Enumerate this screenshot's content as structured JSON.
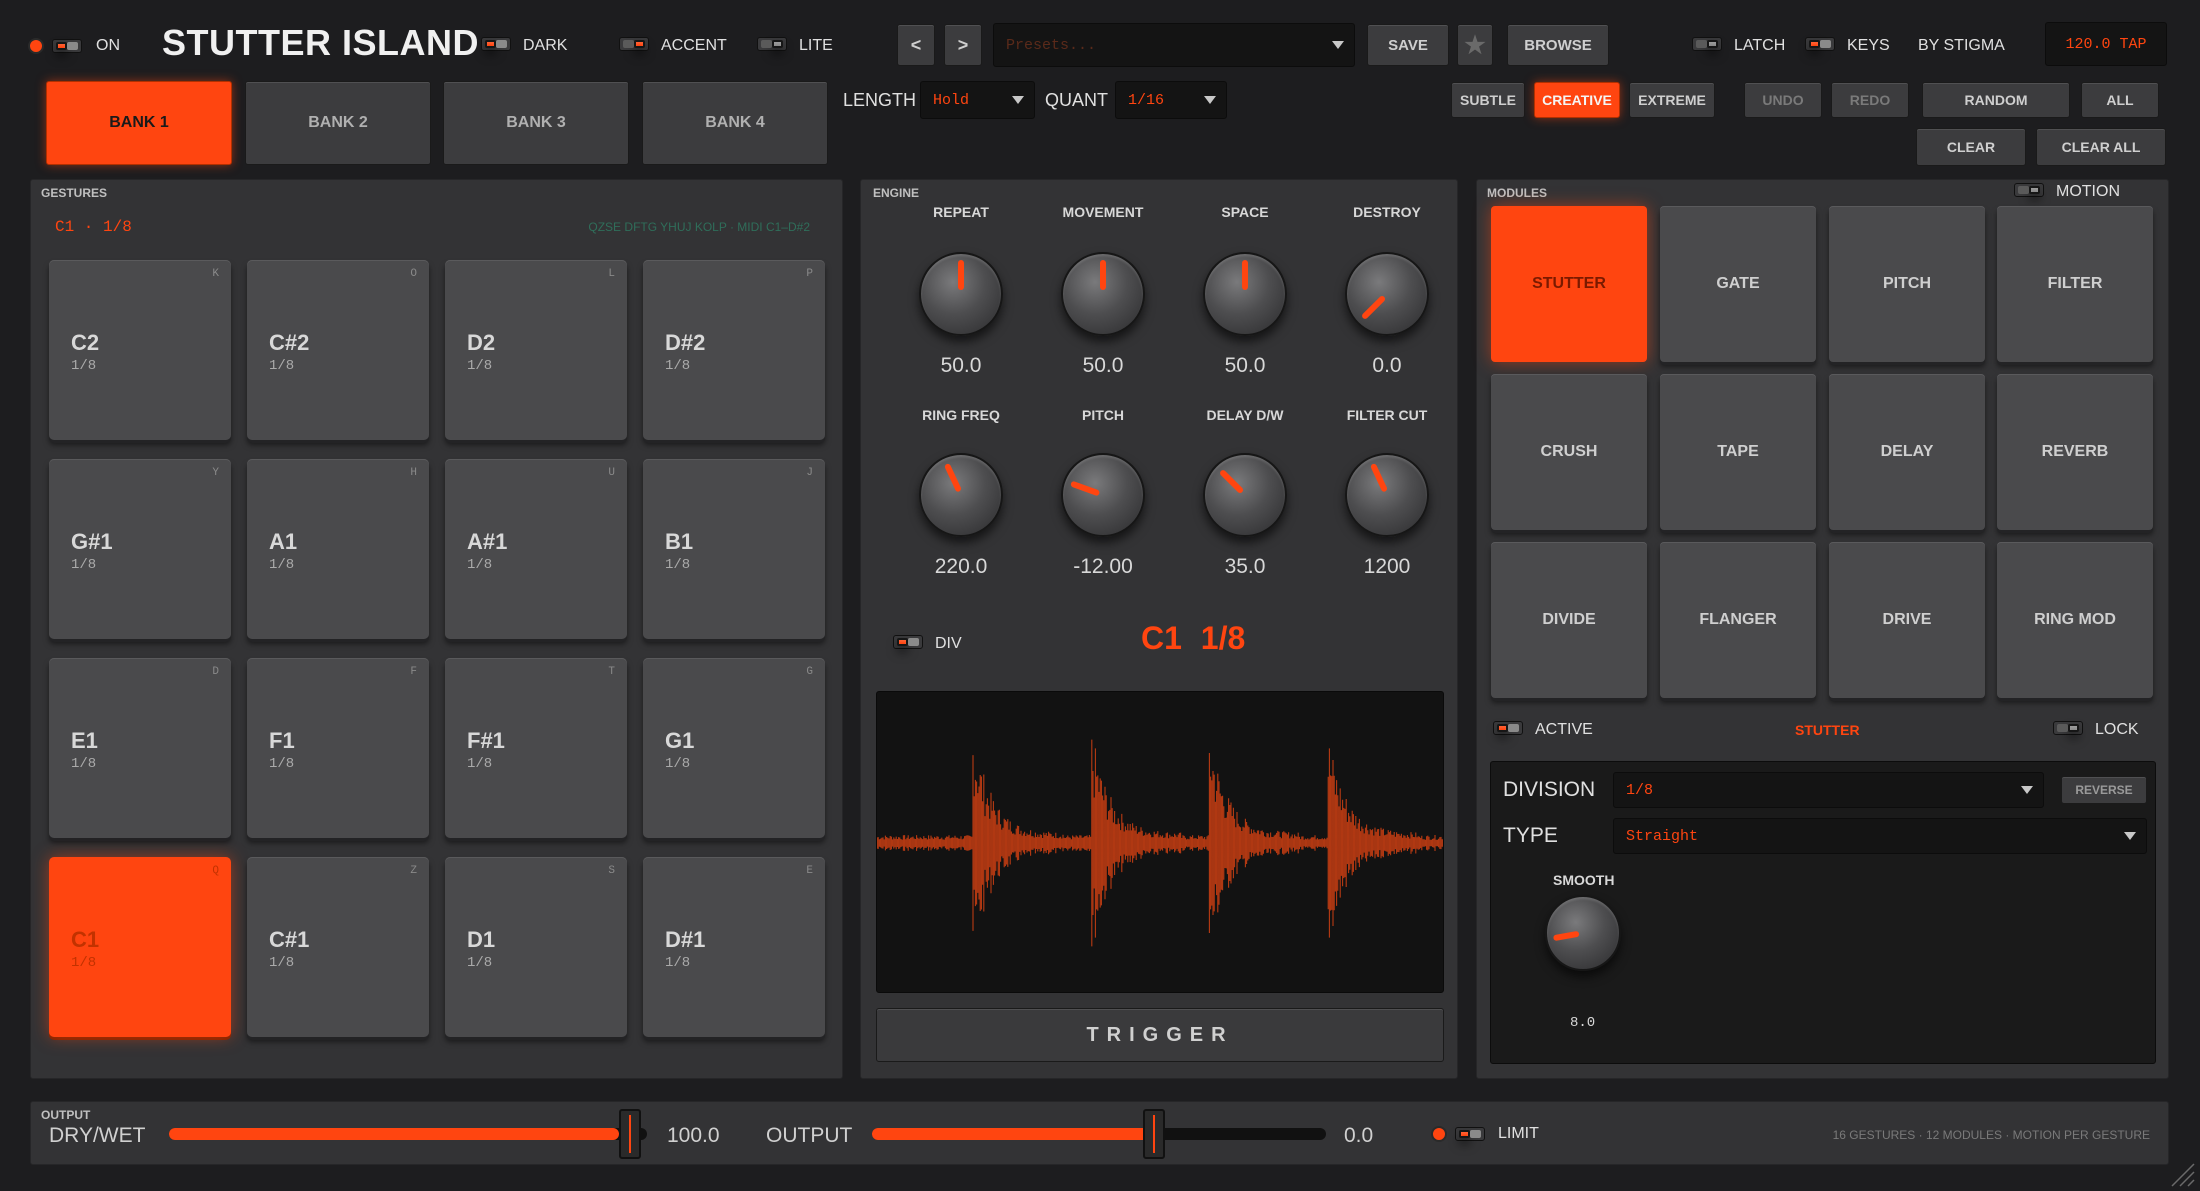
{
  "header": {
    "power_label": "ON",
    "title": "STUTTER ISLAND",
    "dark_label": "DARK",
    "accent_label": "ACCENT",
    "lite_label": "LITE",
    "prev_label": "<",
    "next_label": ">",
    "preset_placeholder": "Presets...",
    "save_label": "SAVE",
    "browse_label": "BROWSE",
    "latch_label": "LATCH",
    "keys_label": "KEYS",
    "by_label": "BY STIGMA",
    "tempo_label": "120.0 TAP"
  },
  "banks": [
    "BANK 1",
    "BANK 2",
    "BANK 3",
    "BANK 4"
  ],
  "controls": {
    "length_label": "LENGTH",
    "length_value": "Hold",
    "quant_label": "QUANT",
    "quant_value": "1/16",
    "subtle": "SUBTLE",
    "creative": "CREATIVE",
    "extreme": "EXTREME",
    "undo": "UNDO",
    "redo": "REDO",
    "random": "RANDOM",
    "all": "ALL",
    "clear": "CLEAR",
    "clear_all": "CLEAR ALL"
  },
  "gestures": {
    "title": "GESTURES",
    "current": "C1 · 1/8",
    "hint": "QZSE DFTG YHUJ KOLP · MIDI C1–D#2",
    "pads": [
      {
        "note": "C2",
        "div": "1/8",
        "key": "K"
      },
      {
        "note": "C#2",
        "div": "1/8",
        "key": "O"
      },
      {
        "note": "D2",
        "div": "1/8",
        "key": "L"
      },
      {
        "note": "D#2",
        "div": "1/8",
        "key": "P"
      },
      {
        "note": "G#1",
        "div": "1/8",
        "key": "Y"
      },
      {
        "note": "A1",
        "div": "1/8",
        "key": "H"
      },
      {
        "note": "A#1",
        "div": "1/8",
        "key": "U"
      },
      {
        "note": "B1",
        "div": "1/8",
        "key": "J"
      },
      {
        "note": "E1",
        "div": "1/8",
        "key": "D"
      },
      {
        "note": "F1",
        "div": "1/8",
        "key": "F"
      },
      {
        "note": "F#1",
        "div": "1/8",
        "key": "T"
      },
      {
        "note": "G1",
        "div": "1/8",
        "key": "G"
      },
      {
        "note": "C1",
        "div": "1/8",
        "key": "Q"
      },
      {
        "note": "C#1",
        "div": "1/8",
        "key": "Z"
      },
      {
        "note": "D1",
        "div": "1/8",
        "key": "S"
      },
      {
        "note": "D#1",
        "div": "1/8",
        "key": "E"
      }
    ]
  },
  "engine": {
    "title": "ENGINE",
    "knobs": [
      {
        "label": "REPEAT",
        "value": "50.0",
        "angle": 0
      },
      {
        "label": "MOVEMENT",
        "value": "50.0",
        "angle": 0
      },
      {
        "label": "SPACE",
        "value": "50.0",
        "angle": 0
      },
      {
        "label": "DESTROY",
        "value": "0.0",
        "angle": -135
      },
      {
        "label": "RING FREQ",
        "value": "220.0",
        "angle": -25
      },
      {
        "label": "PITCH",
        "value": "-12.00",
        "angle": -70
      },
      {
        "label": "DELAY D/W",
        "value": "35.0",
        "angle": -45
      },
      {
        "label": "FILTER CUT",
        "value": "1200",
        "angle": -25
      }
    ],
    "div_label": "DIV",
    "display": "C1  1/8",
    "trigger_label": "TRIGGER"
  },
  "modules": {
    "title": "MODULES",
    "motion_label": "MOTION",
    "items": [
      "STUTTER",
      "GATE",
      "PITCH",
      "FILTER",
      "CRUSH",
      "TAPE",
      "DELAY",
      "REVERB",
      "DIVIDE",
      "FLANGER",
      "DRIVE",
      "RING MOD"
    ],
    "active_label": "ACTIVE",
    "selected": "STUTTER",
    "lock_label": "LOCK",
    "division_label": "DIVISION",
    "division_value": "1/8",
    "reverse_label": "REVERSE",
    "type_label": "TYPE",
    "type_value": "Straight",
    "smooth_label": "SMOOTH",
    "smooth_value": "8.0"
  },
  "output": {
    "title": "OUTPUT",
    "drywet_label": "DRY/WET",
    "drywet_value": "100.0",
    "drywet_fraction": 1.0,
    "output_label": "OUTPUT",
    "output_value": "0.0",
    "limit_label": "LIMIT",
    "footer_info": "16 GESTURES · 12 MODULES · MOTION PER GESTURE"
  },
  "colors": {
    "accent": "#ff4510",
    "background": "#1d1d1f",
    "panel": "#333335"
  }
}
